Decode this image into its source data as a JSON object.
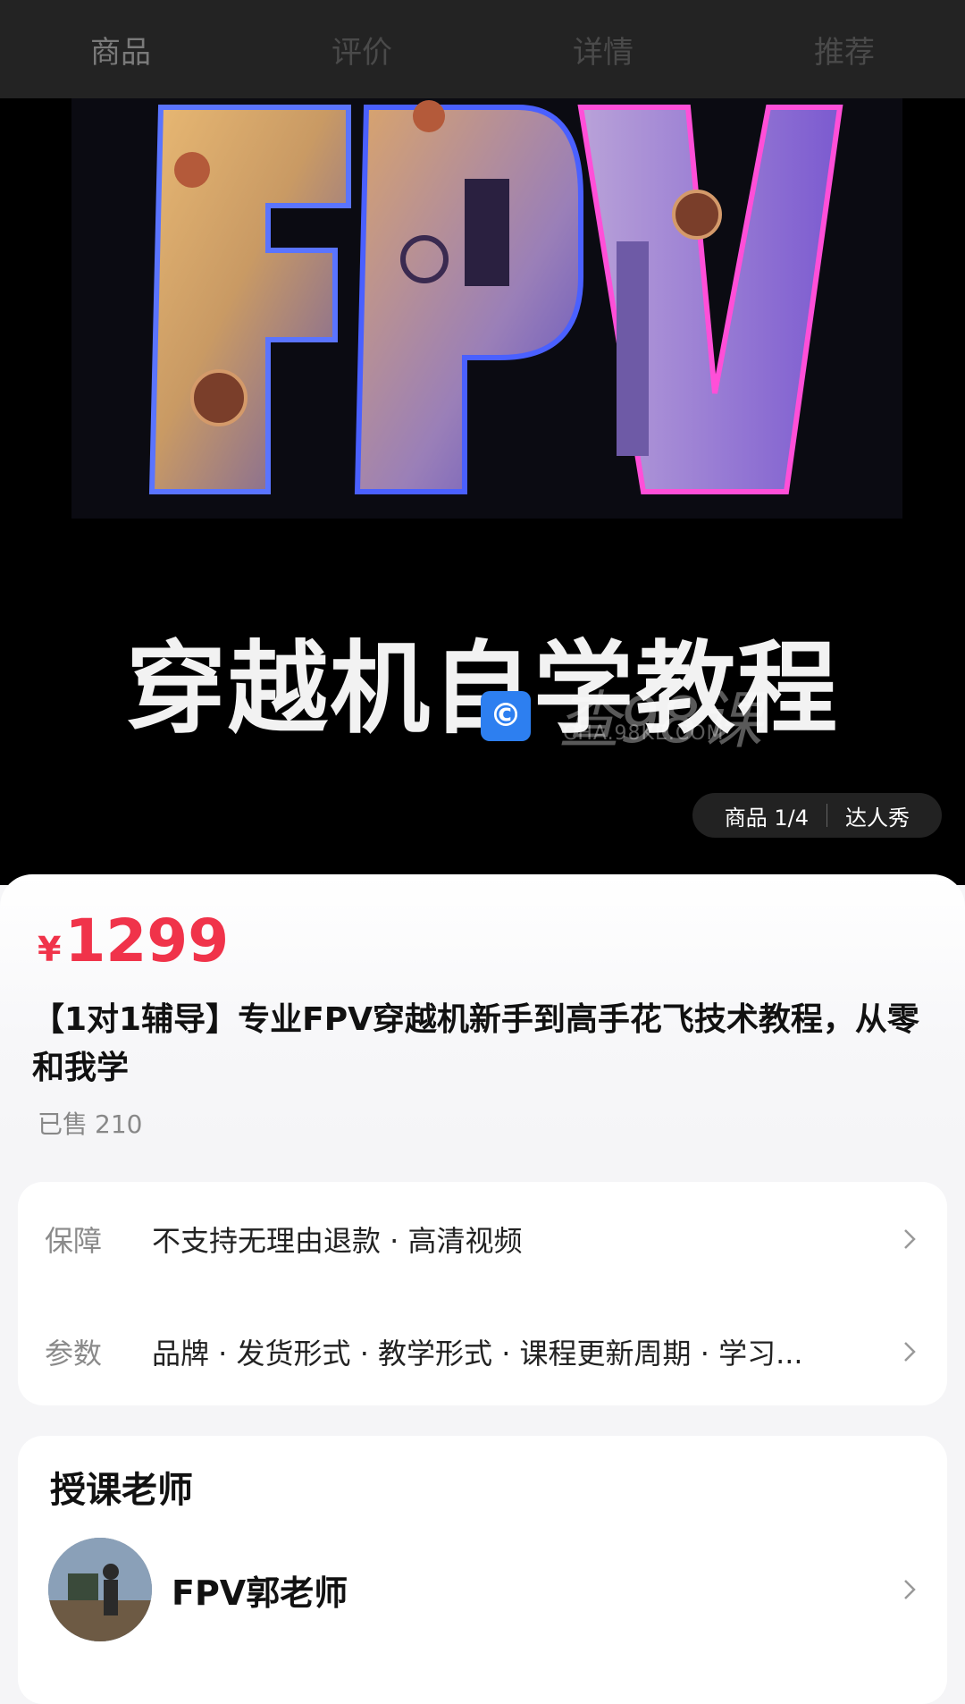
{
  "nav": {
    "tabs": [
      {
        "label": "商品"
      },
      {
        "label": "评价"
      },
      {
        "label": "详情"
      },
      {
        "label": "推荐"
      }
    ]
  },
  "hero": {
    "logo_text": "FPV",
    "title": "穿越机自学教程",
    "watermark": {
      "text": "查98课",
      "sub": "CHA.98KE.COM"
    },
    "pill": {
      "product": "商品 1/4",
      "show": "达人秀"
    }
  },
  "product": {
    "currency": "¥",
    "price": "1299",
    "title": "【1对1辅导】专业FPV穿越机新手到高手花飞技术教程，从零和我学",
    "sold_label": "已售",
    "sold_count": "210"
  },
  "info": {
    "rows": [
      {
        "label": "保障",
        "value": "不支持无理由退款 · 高清视频"
      },
      {
        "label": "参数",
        "value": "品牌 · 发货形式 · 教学形式 · 课程更新周期 · 学习..."
      }
    ]
  },
  "teacher": {
    "heading": "授课老师",
    "name": "FPV郭老师"
  },
  "colors": {
    "price": "#f0334a",
    "nav_bg": "#232323"
  }
}
